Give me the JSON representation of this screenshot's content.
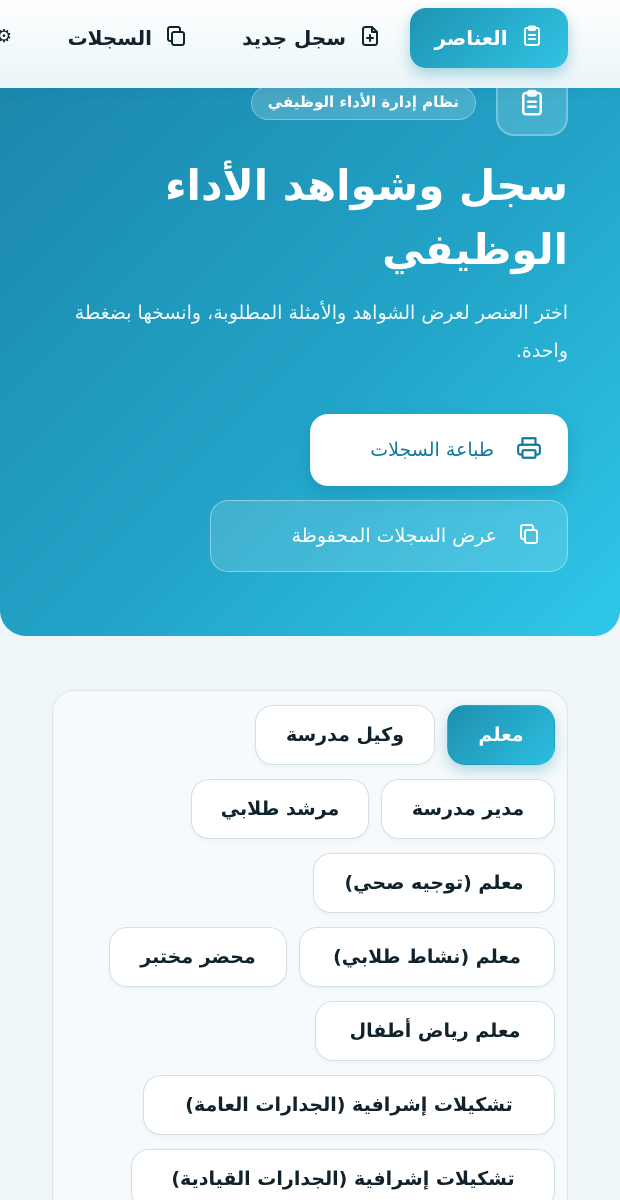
{
  "nav": {
    "tabs": [
      {
        "label": "العناصر",
        "icon": "clipboard-icon",
        "active": true
      },
      {
        "label": "سجل جديد",
        "icon": "file-plus-icon",
        "active": false
      },
      {
        "label": "السجلات",
        "icon": "copy-icon",
        "active": false
      }
    ],
    "overflow_icon": "gear-icon"
  },
  "hero": {
    "badge": "نظام إدارة الأداء الوظيفي",
    "title": "سجل وشواهد الأداء الوظيفي",
    "description": "اختر العنصر لعرض الشواهد والأمثلة المطلوبة، وانسخها بضغطة واحدة.",
    "print_button": "طباعة السجلات",
    "saved_button": "عرض السجلات المحفوظة"
  },
  "roles": {
    "selected": "معلم",
    "items": [
      "معلم",
      "وكيل مدرسة",
      "مدير مدرسة",
      "مرشد طلابي",
      "معلم (توجيه صحي)",
      "معلم (نشاط طلابي)",
      "محضر مختبر",
      "معلم رياض أطفال",
      "تشكيلات إشرافية (الجدارات العامة)",
      "تشكيلات إشرافية (الجدارات القيادية)"
    ]
  },
  "colors": {
    "accent": "#22a4c8",
    "accent_dark": "#1c87ad",
    "accent_light": "#2fc8e9"
  }
}
